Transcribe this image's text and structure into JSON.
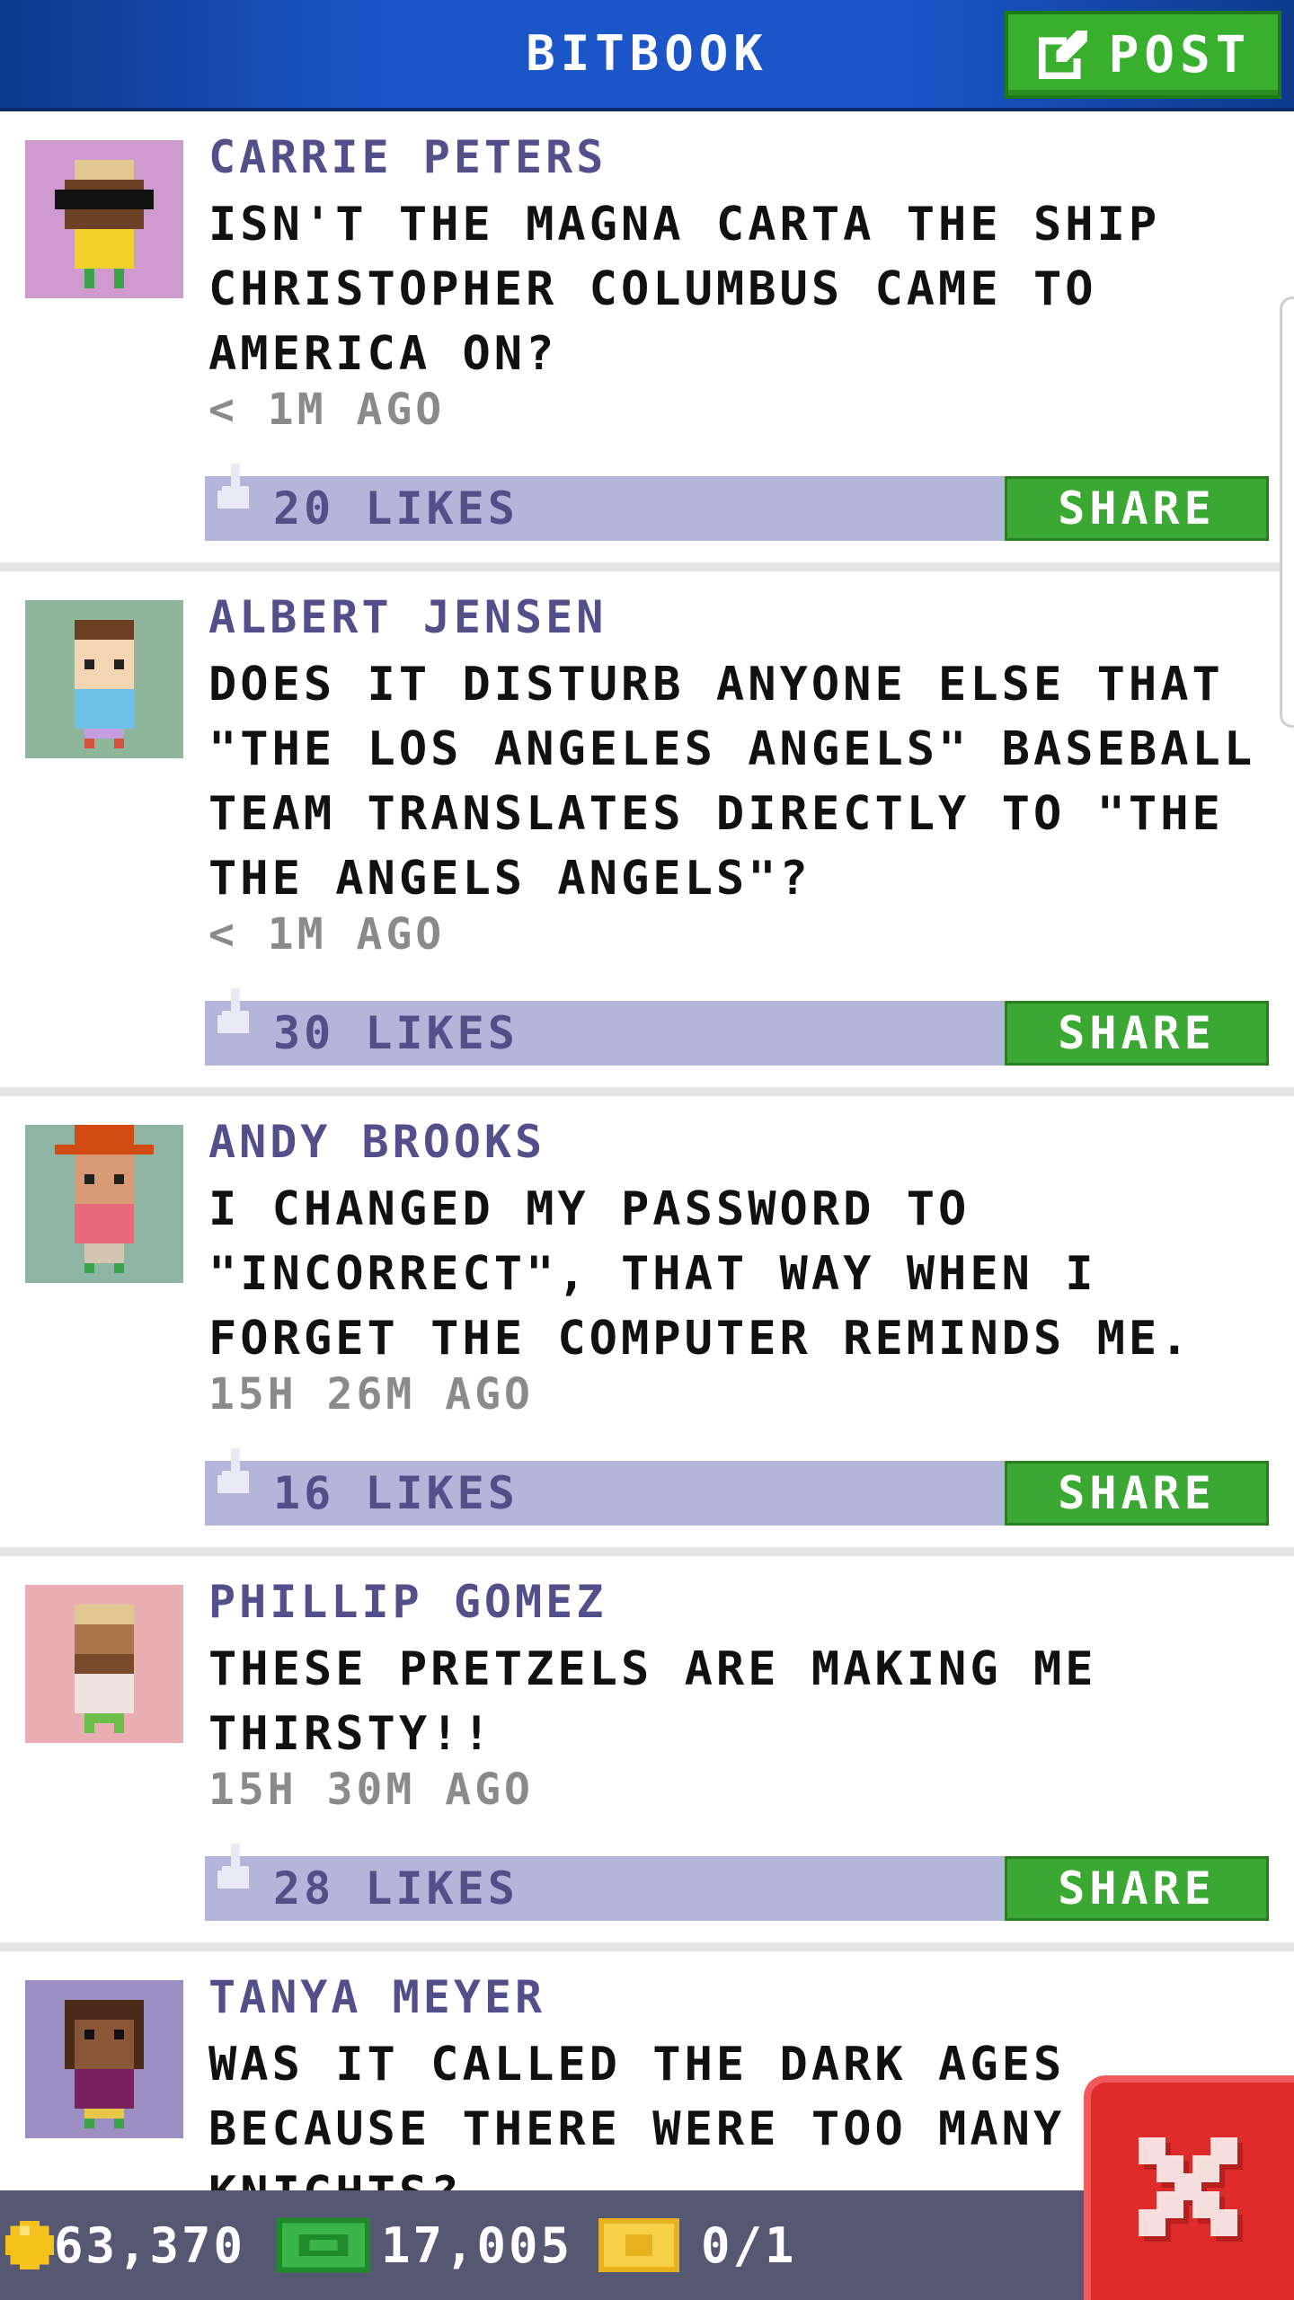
{
  "header": {
    "title": "BITBOOK",
    "post_label": "POST"
  },
  "posts": [
    {
      "author": "CARRIE PETERS",
      "lines": [
        "ISN'T THE MAGNA CARTA THE SHIP",
        "CHRISTOPHER COLUMBUS CAME TO",
        "AMERICA ON?"
      ],
      "time": "< 1M AGO",
      "likes": "20 LIKES",
      "share": "SHARE",
      "avatar_bg": "#cf9bcf"
    },
    {
      "author": "ALBERT JENSEN",
      "lines": [
        "DOES IT DISTURB ANYONE ELSE THAT",
        "\"THE LOS ANGELES ANGELS\" BASEBALL",
        "TEAM TRANSLATES DIRECTLY TO \"THE",
        "THE ANGELS ANGELS\"?"
      ],
      "time": "< 1M AGO",
      "likes": "30 LIKES",
      "share": "SHARE",
      "avatar_bg": "#8fb59a"
    },
    {
      "author": "ANDY BROOKS",
      "lines": [
        "I CHANGED MY PASSWORD TO",
        "\"INCORRECT\", THAT WAY WHEN I",
        "FORGET THE COMPUTER REMINDS ME."
      ],
      "time": "15H 26M AGO",
      "likes": "16 LIKES",
      "share": "SHARE",
      "avatar_bg": "#8fb5a5"
    },
    {
      "author": "PHILLIP GOMEZ",
      "lines": [
        "THESE PRETZELS ARE MAKING ME",
        "THIRSTY!!"
      ],
      "time": "15H 30M AGO",
      "likes": "28 LIKES",
      "share": "SHARE",
      "avatar_bg": "#e8aeb1"
    },
    {
      "author": "TANYA MEYER",
      "lines": [
        "WAS IT CALLED THE DARK AGES",
        "BECAUSE THERE WERE TOO MANY",
        "KNIGHTS?"
      ],
      "avatar_bg": "#9b8fc4"
    }
  ],
  "status": {
    "coins": "63,370",
    "bux": "17,005",
    "tickets": "0/1"
  },
  "colors": {
    "header": "#1c55c8",
    "accent_green": "#3aa832",
    "likes_bar": "#b3b6d9",
    "close_red": "#e02b2b"
  }
}
